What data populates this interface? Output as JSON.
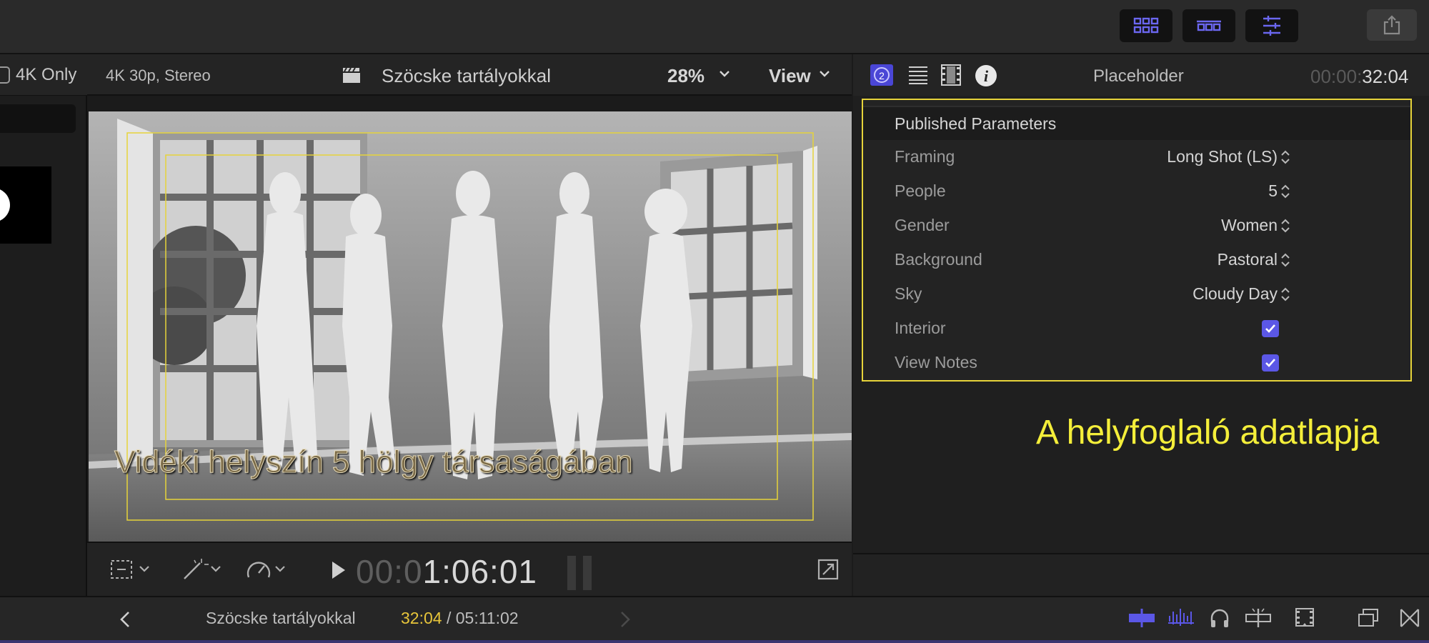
{
  "toolbar": {
    "buttons": [
      {
        "name": "library-browser-icon"
      },
      {
        "name": "timeline-index-icon"
      },
      {
        "name": "inspector-toggle-icon"
      }
    ],
    "share_icon": "share-icon",
    "accent_color": "#5b57e6"
  },
  "browser": {
    "filter_label": "4K Only"
  },
  "viewer": {
    "format": "4K 30p, Stereo",
    "clip_title": "Szöcske tartályokkal",
    "zoom": "28%",
    "view_menu": "View",
    "caption": "Vidéki helyszín 5 hölgy társaságában",
    "timecode_dim": "00:0",
    "timecode_bright": "1:06:01"
  },
  "inspector": {
    "title": "Placeholder",
    "timecode_dim": "00:00:",
    "timecode_bright": "32:04",
    "section_title": "Published Parameters",
    "params": [
      {
        "label": "Framing",
        "value": "Long Shot (LS)",
        "type": "popup"
      },
      {
        "label": "People",
        "value": "5",
        "type": "popup"
      },
      {
        "label": "Gender",
        "value": "Women",
        "type": "popup"
      },
      {
        "label": "Background",
        "value": "Pastoral",
        "type": "popup"
      },
      {
        "label": "Sky",
        "value": "Cloudy Day",
        "type": "popup"
      },
      {
        "label": "Interior",
        "checked": true,
        "type": "checkbox"
      },
      {
        "label": "View Notes",
        "checked": true,
        "type": "checkbox"
      }
    ],
    "annotation": "A helyfoglaló adatlapja",
    "annotation_color": "#f4ee3a"
  },
  "timeline": {
    "project": "Szöcske tartályokkal",
    "current": "32:04",
    "separator": " / ",
    "total": "05:11:02"
  }
}
